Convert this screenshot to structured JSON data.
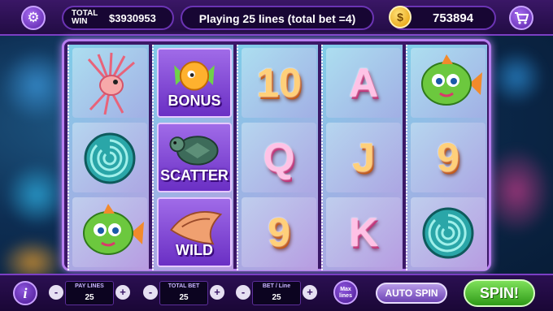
{
  "top_bar": {
    "settings_icon": "gear-icon",
    "total_win_label": "TOTAL WIN",
    "total_win_value": "$3930953",
    "lines_status": "Playing 25 lines (total bet =4)",
    "coin_icon": "dollar-coin-icon",
    "coin_symbol": "$",
    "coin_balance": "753894",
    "shop_icon": "shopping-cart-icon"
  },
  "reels": [
    {
      "symbols": [
        {
          "type": "picture",
          "name": "lionfish"
        },
        {
          "type": "picture",
          "name": "nautilus-shell"
        },
        {
          "type": "picture",
          "name": "green-fish"
        }
      ]
    },
    {
      "symbols": [
        {
          "type": "special",
          "name": "bonus-fish",
          "label": "BONUS"
        },
        {
          "type": "special",
          "name": "sea-turtle",
          "label": "SCATTER"
        },
        {
          "type": "special",
          "name": "conch-shell",
          "label": "WILD"
        }
      ]
    },
    {
      "symbols": [
        {
          "type": "letter",
          "text": "10"
        },
        {
          "type": "letter",
          "text": "Q"
        },
        {
          "type": "letter",
          "text": "9"
        }
      ]
    },
    {
      "symbols": [
        {
          "type": "letter",
          "text": "A"
        },
        {
          "type": "letter",
          "text": "J"
        },
        {
          "type": "letter",
          "text": "K"
        }
      ]
    },
    {
      "symbols": [
        {
          "type": "picture",
          "name": "green-fish"
        },
        {
          "type": "letter",
          "text": "9"
        },
        {
          "type": "picture",
          "name": "nautilus-shell"
        }
      ]
    }
  ],
  "bottom_bar": {
    "info_label": "i",
    "pay_lines": {
      "label": "PAY LINES",
      "value": "25",
      "minus": "-",
      "plus": "+"
    },
    "total_bet": {
      "label": "TOTAL BET",
      "value": "25",
      "minus": "-",
      "plus": "+"
    },
    "bet_per_line": {
      "label": "BET / Line",
      "value": "25",
      "minus": "-",
      "plus": "+"
    },
    "max_lines_label": "Max lines",
    "auto_spin_label": "AUTO SPIN",
    "spin_label": "SPIN!"
  }
}
